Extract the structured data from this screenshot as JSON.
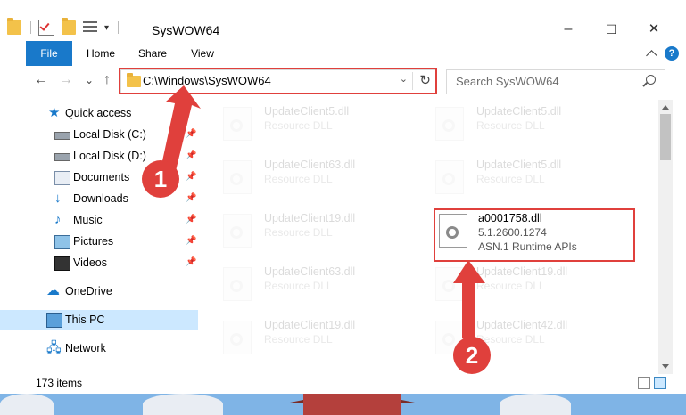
{
  "window": {
    "title": "SysWOW64",
    "controls": {
      "minimize": "–",
      "maximize": "☐",
      "close": "✕"
    }
  },
  "ribbon": {
    "tabs": [
      "File",
      "Home",
      "Share",
      "View"
    ],
    "help": "?"
  },
  "nav": {
    "back": "←",
    "forward": "→",
    "recent": "⌄",
    "up": "↑",
    "address": "C:\\Windows\\SysWOW64",
    "refresh": "↻",
    "search_placeholder": "Search SysWOW64"
  },
  "sidebar": {
    "items": [
      {
        "label": "Quick access",
        "icon": "star-icon"
      },
      {
        "label": "Local Disk (C:)",
        "icon": "disk-icon",
        "pinned": true
      },
      {
        "label": "Local Disk (D:)",
        "icon": "disk-icon",
        "pinned": true
      },
      {
        "label": "Documents",
        "icon": "documents-icon",
        "pinned": true
      },
      {
        "label": "Downloads",
        "icon": "downloads-icon",
        "pinned": true
      },
      {
        "label": "Music",
        "icon": "music-icon",
        "pinned": true
      },
      {
        "label": "Pictures",
        "icon": "pictures-icon",
        "pinned": true
      },
      {
        "label": "Videos",
        "icon": "videos-icon",
        "pinned": true
      },
      {
        "label": "OneDrive",
        "icon": "onedrive-icon"
      },
      {
        "label": "This PC",
        "icon": "pc-icon",
        "selected": true
      },
      {
        "label": "Network",
        "icon": "network-icon"
      }
    ]
  },
  "files": [
    {
      "name": "UpdateClient5.dll",
      "desc": "Resource DLL"
    },
    {
      "name": "UpdateClient5.dll",
      "desc": "Resource DLL"
    },
    {
      "name": "UpdateClient63.dll",
      "desc": "Resource DLL"
    },
    {
      "name": "UpdateClient5.dll",
      "desc": "Resource DLL"
    },
    {
      "name": "UpdateClient19.dll",
      "desc": "Resource DLL"
    },
    {
      "name": "a0001758.dll",
      "version": "5.1.2600.1274",
      "desc": "ASN.1 Runtime APIs"
    },
    {
      "name": "UpdateClient63.dll",
      "desc": "Resource DLL"
    },
    {
      "name": "UpdateClient19.dll",
      "desc": "Resource DLL"
    },
    {
      "name": "UpdateClient19.dll",
      "desc": "Resource DLL"
    },
    {
      "name": "UpdateClient42.dll",
      "desc": "Resource DLL"
    }
  ],
  "status": {
    "items": "173 items"
  },
  "callouts": [
    "1",
    "2"
  ],
  "colors": {
    "accent": "#1979ca",
    "highlight": "#e0403c",
    "selected": "#cce8ff"
  }
}
